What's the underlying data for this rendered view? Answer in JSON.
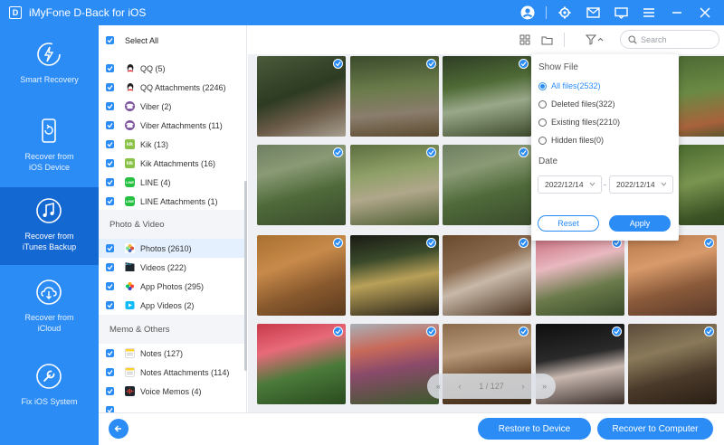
{
  "app": {
    "title": "iMyFone D-Back for iOS",
    "logo_letter": "D",
    "accent_color": "#2b8cf5",
    "titlebar_icons": [
      "account-icon",
      "gear-icon",
      "mail-icon",
      "feedback-icon",
      "menu-icon",
      "minimize-icon",
      "close-icon"
    ]
  },
  "sidebar": {
    "items": [
      {
        "label": "Smart Recovery",
        "icon": "smart-recovery-icon",
        "active": false
      },
      {
        "label": "Recover from\niOS Device",
        "icon": "ios-device-icon",
        "active": false
      },
      {
        "label": "Recover from\niTunes Backup",
        "icon": "itunes-backup-icon",
        "active": true
      },
      {
        "label": "Recover from\niCloud",
        "icon": "icloud-icon",
        "active": false
      },
      {
        "label": "Fix iOS System",
        "icon": "wrench-icon",
        "active": false
      }
    ]
  },
  "categories": {
    "select_all": "Select All",
    "groups": [
      {
        "items": [
          {
            "label": "QQ (5)",
            "icon": "qq-icon"
          },
          {
            "label": "QQ Attachments (2246)",
            "icon": "qq-icon"
          },
          {
            "label": "Viber (2)",
            "icon": "viber-icon"
          },
          {
            "label": "Viber Attachments (11)",
            "icon": "viber-icon"
          },
          {
            "label": "Kik (13)",
            "icon": "kik-icon"
          },
          {
            "label": "Kik Attachments (16)",
            "icon": "kik-icon"
          },
          {
            "label": "LINE (4)",
            "icon": "line-icon"
          },
          {
            "label": "LINE Attachments (1)",
            "icon": "line-icon"
          }
        ]
      },
      {
        "header": "Photo & Video",
        "items": [
          {
            "label": "Photos (2610)",
            "icon": "photos-icon",
            "selected": true
          },
          {
            "label": "Videos (222)",
            "icon": "videos-icon"
          },
          {
            "label": "App Photos (295)",
            "icon": "app-photos-icon"
          },
          {
            "label": "App Videos (2)",
            "icon": "app-videos-icon"
          }
        ]
      },
      {
        "header": "Memo & Others",
        "items": [
          {
            "label": "Notes (127)",
            "icon": "notes-icon"
          },
          {
            "label": "Notes Attachments (114)",
            "icon": "notes-icon"
          },
          {
            "label": "Voice Memos (4)",
            "icon": "voice-memos-icon"
          }
        ]
      }
    ]
  },
  "toolbar": {
    "search_placeholder": "Search",
    "icons": [
      "grid-view-icon",
      "folder-view-icon",
      "filter-icon"
    ]
  },
  "filter": {
    "show_file_title": "Show File",
    "options": [
      {
        "label": "All files(2532)",
        "checked": true
      },
      {
        "label": "Deleted files(322)",
        "checked": false
      },
      {
        "label": "Existing files(2210)",
        "checked": false
      },
      {
        "label": "Hidden files(0)",
        "checked": false
      }
    ],
    "date_title": "Date",
    "date_from": "2022/12/14",
    "date_to": "2022/12/14",
    "date_separator": "-",
    "reset_label": "Reset",
    "apply_label": "Apply"
  },
  "pager": {
    "first": "«",
    "prev": "‹",
    "page_text": "1 / 127",
    "next": "›",
    "last": "»"
  },
  "buttons": {
    "restore_device": "Restore to Device",
    "recover_computer": "Recover to Computer"
  }
}
